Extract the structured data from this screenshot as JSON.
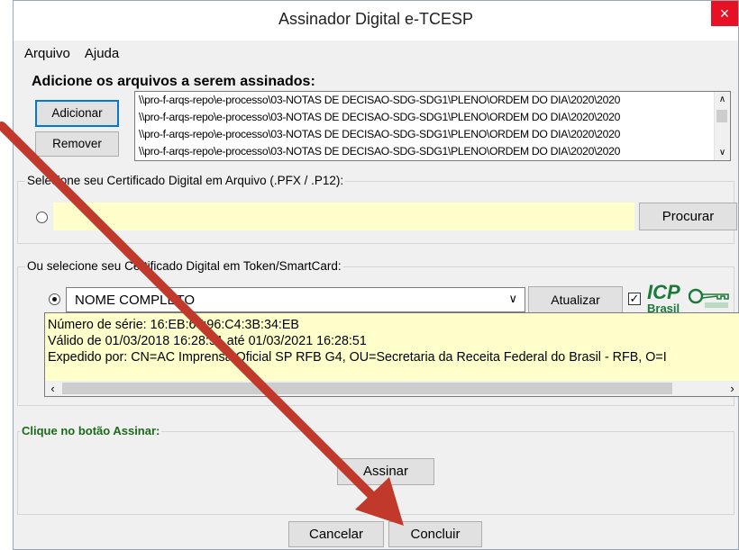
{
  "window": {
    "title": "Assinador Digital e-TCESP",
    "close_label": "×"
  },
  "menu": {
    "items": [
      "Arquivo",
      "Ajuda"
    ]
  },
  "files_group": {
    "title": "Adicione os arquivos a serem assinados:",
    "add_label": "Adicionar",
    "remove_label": "Remover",
    "files": [
      "\\\\pro-f-arqs-repo\\e-processo\\03-NOTAS DE DECISAO-SDG-SDG1\\PLENO\\ORDEM DO DIA\\2020\\2020",
      "\\\\pro-f-arqs-repo\\e-processo\\03-NOTAS DE DECISAO-SDG-SDG1\\PLENO\\ORDEM DO DIA\\2020\\2020",
      "\\\\pro-f-arqs-repo\\e-processo\\03-NOTAS DE DECISAO-SDG-SDG1\\PLENO\\ORDEM DO DIA\\2020\\2020",
      "\\\\pro-f-arqs-repo\\e-processo\\03-NOTAS DE DECISAO-SDG-SDG1\\PLENO\\ORDEM DO DIA\\2020\\2020"
    ]
  },
  "cert_file_group": {
    "title": "Selecione seu Certificado Digital em Arquivo (.PFX / .P12):",
    "browse_label": "Procurar"
  },
  "token_group": {
    "title": "Ou selecione seu Certificado Digital em Token/SmartCard:",
    "selected_cert": "NOME COMPLETO",
    "refresh_label": "Atualizar",
    "logo_text": "ICP",
    "logo_sub": "Brasil",
    "details": [
      "Número de série: 16:EB:67:96:C4:3B:34:EB",
      "Válido de 01/03/2018 16:28:51 até 01/03/2021 16:28:51",
      "Expedido por: CN=AC Imprensa Oficial SP RFB G4, OU=Secretaria da Receita Federal do Brasil - RFB, O=I"
    ]
  },
  "sign_group": {
    "title": "Clique no botão Assinar:",
    "sign_label": "Assinar"
  },
  "footer": {
    "cancel_label": "Cancelar",
    "finish_label": "Concluir"
  },
  "colors": {
    "arrow": "#c0392b",
    "highlight": "#ffffcc",
    "accent": "#0078d7"
  }
}
